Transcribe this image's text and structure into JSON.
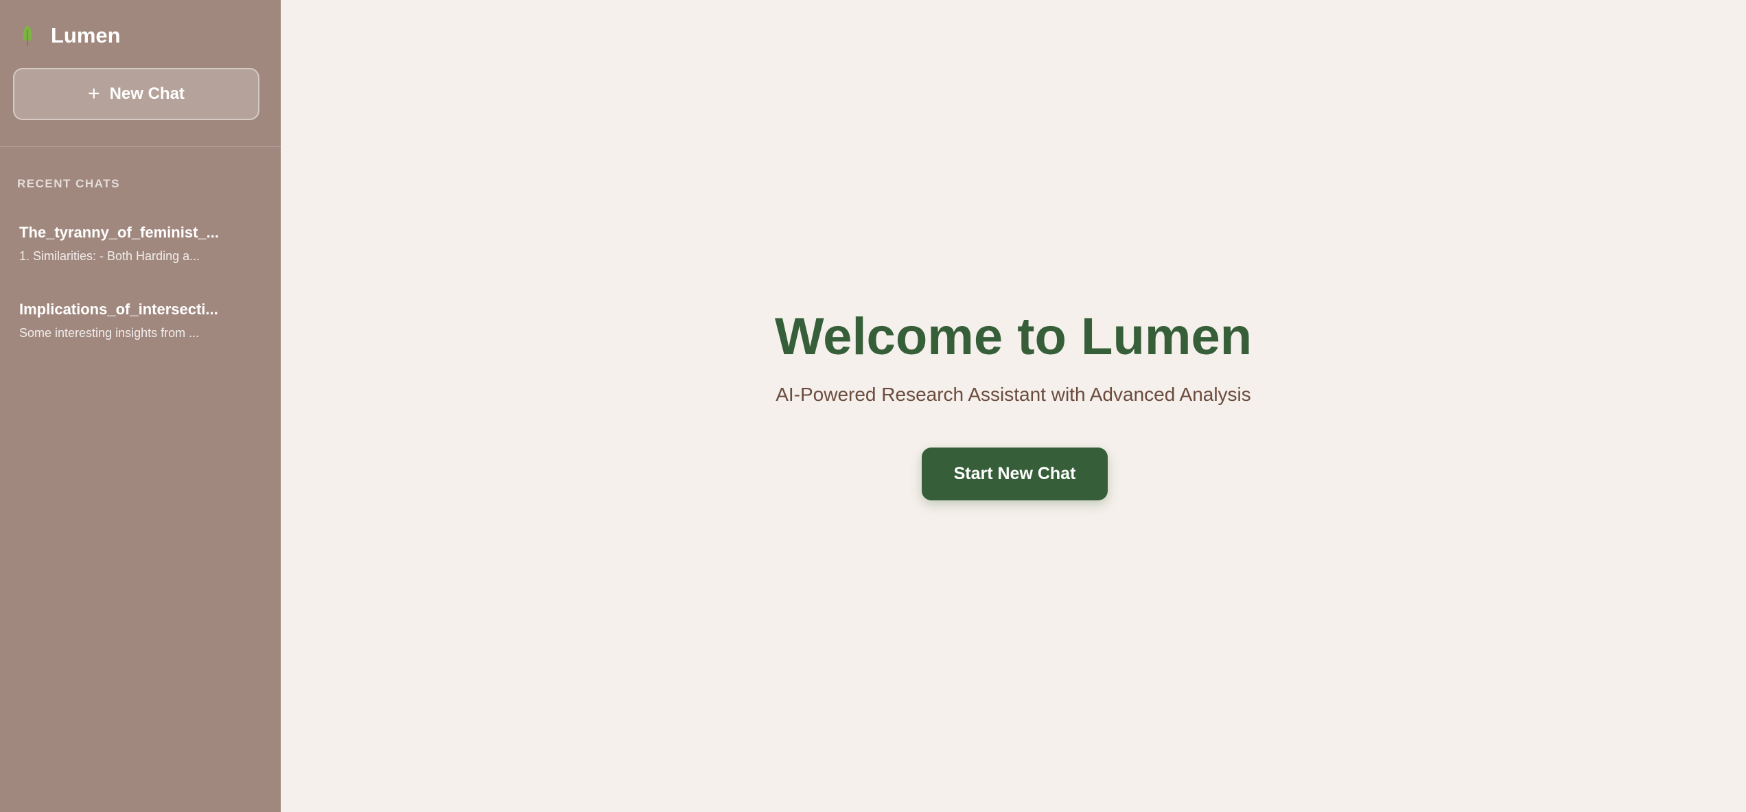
{
  "app": {
    "name": "Lumen",
    "logo_icon": "tree-icon",
    "logo_color": "#7cb342"
  },
  "sidebar": {
    "new_chat_label": "New Chat",
    "new_chat_icon": "plus-icon",
    "recent_header": "RECENT CHATS",
    "chats": [
      {
        "title": "The_tyranny_of_feminist_...",
        "preview": "1. Similarities: - Both Harding a..."
      },
      {
        "title": "Implications_of_intersecti...",
        "preview": "Some interesting insights from ..."
      }
    ]
  },
  "main": {
    "welcome_title": "Welcome to Lumen",
    "subtitle": "AI-Powered Research Assistant with Advanced Analysis",
    "start_button_label": "Start New Chat"
  },
  "colors": {
    "sidebar_bg": "#a1887e",
    "main_bg": "#f5f0eb",
    "accent_green": "#365e38",
    "subtitle_brown": "#6b4b3e"
  }
}
